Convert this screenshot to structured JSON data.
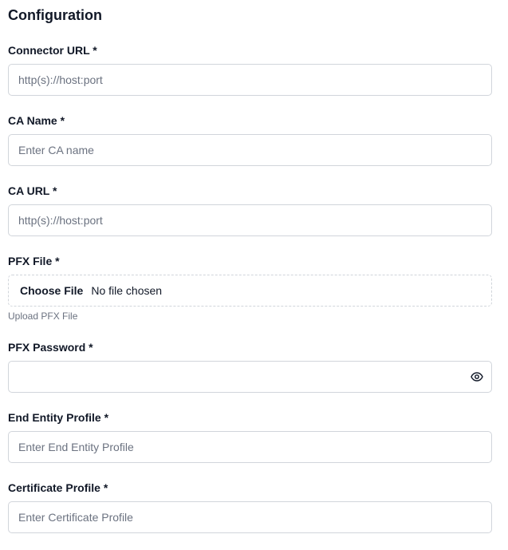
{
  "section_title": "Configuration",
  "fields": {
    "connector_url": {
      "label": "Connector URL *",
      "placeholder": "http(s)://host:port",
      "value": ""
    },
    "ca_name": {
      "label": "CA Name *",
      "placeholder": "Enter CA name",
      "value": ""
    },
    "ca_url": {
      "label": "CA URL *",
      "placeholder": "http(s)://host:port",
      "value": ""
    },
    "pfx_file": {
      "label": "PFX File *",
      "button_label": "Choose File",
      "status": "No file chosen",
      "helper": "Upload PFX File"
    },
    "pfx_password": {
      "label": "PFX Password *",
      "value": "",
      "toggle_icon": "eye-icon"
    },
    "end_entity_profile": {
      "label": "End Entity Profile *",
      "placeholder": "Enter End Entity Profile",
      "value": ""
    },
    "certificate_profile": {
      "label": "Certificate Profile *",
      "placeholder": "Enter Certificate Profile",
      "value": ""
    }
  },
  "colors": {
    "border": "#d1d5db",
    "placeholder": "#6b7280",
    "text": "#111827"
  }
}
